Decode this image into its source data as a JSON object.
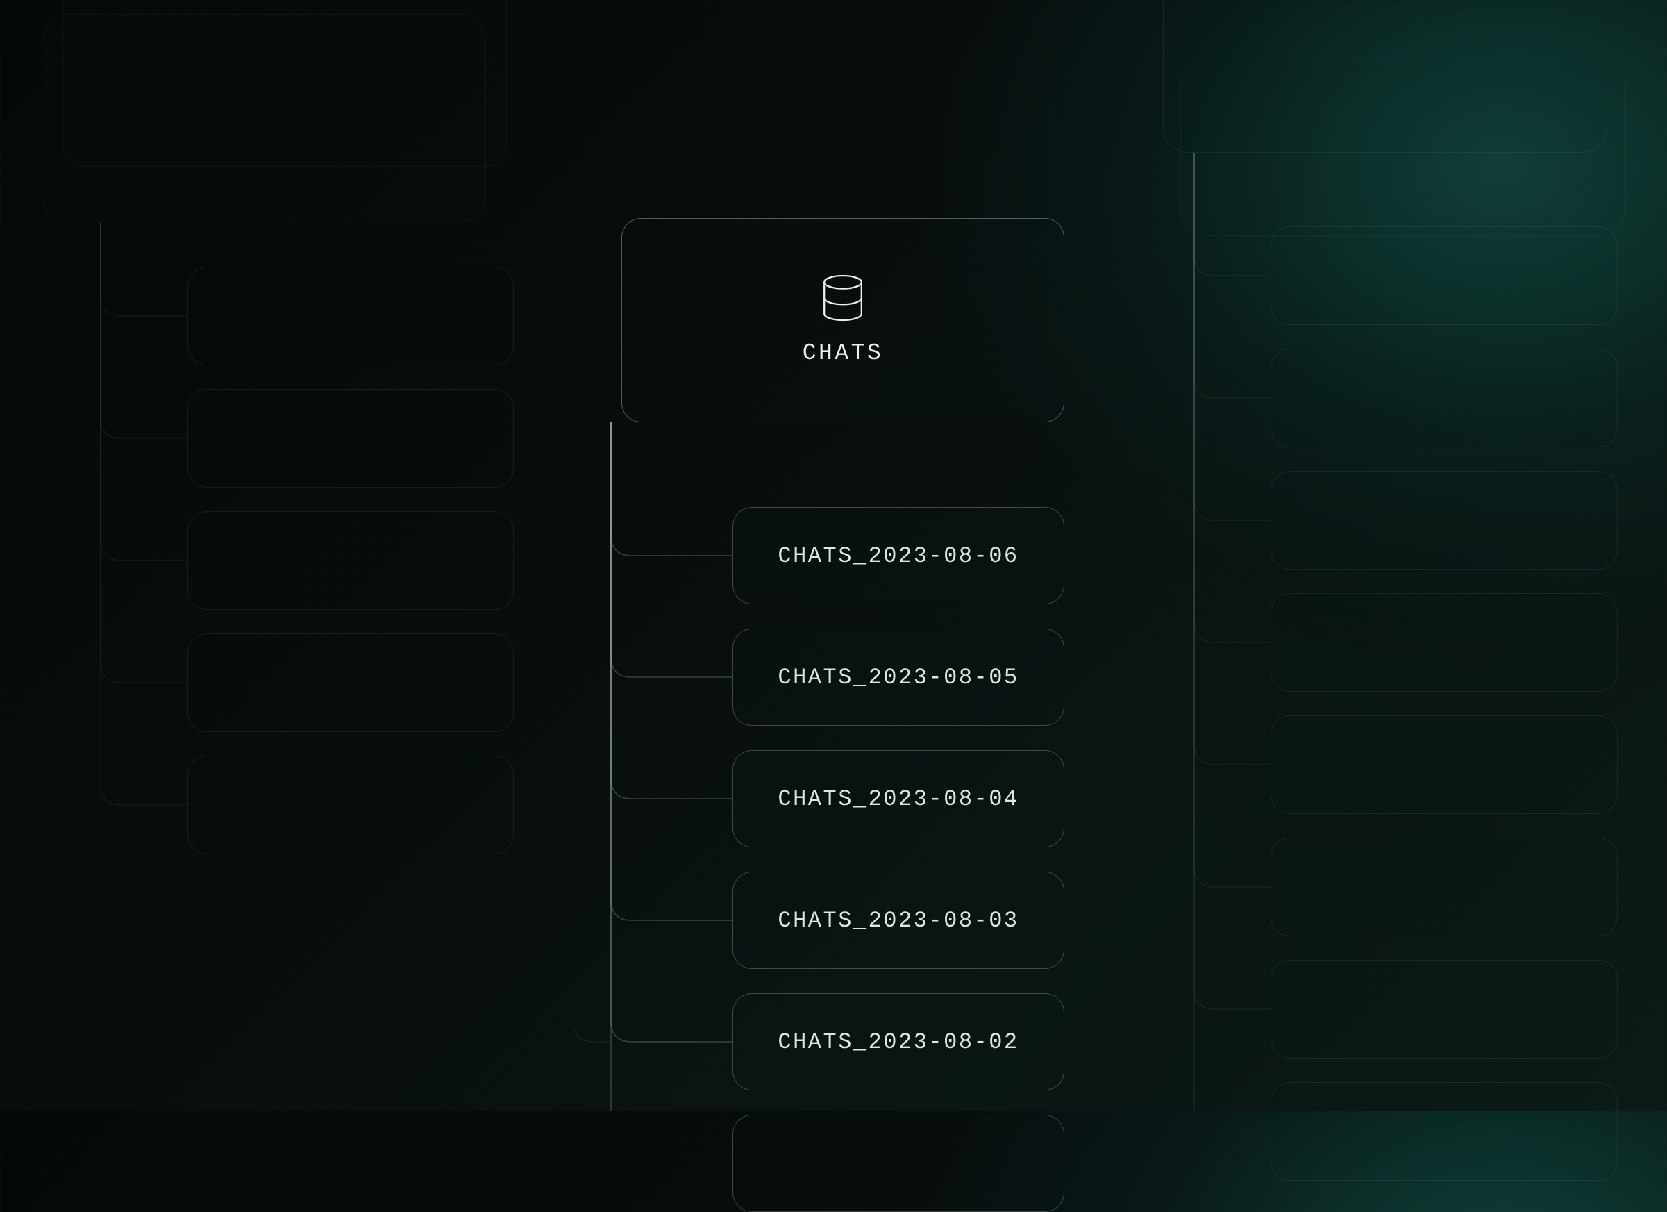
{
  "root": {
    "label": "CHATS",
    "icon": "database-icon"
  },
  "children": [
    {
      "label": "CHATS_2023-08-06"
    },
    {
      "label": "CHATS_2023-08-05"
    },
    {
      "label": "CHATS_2023-08-04"
    },
    {
      "label": "CHATS_2023-08-03"
    },
    {
      "label": "CHATS_2023-08-02"
    }
  ]
}
